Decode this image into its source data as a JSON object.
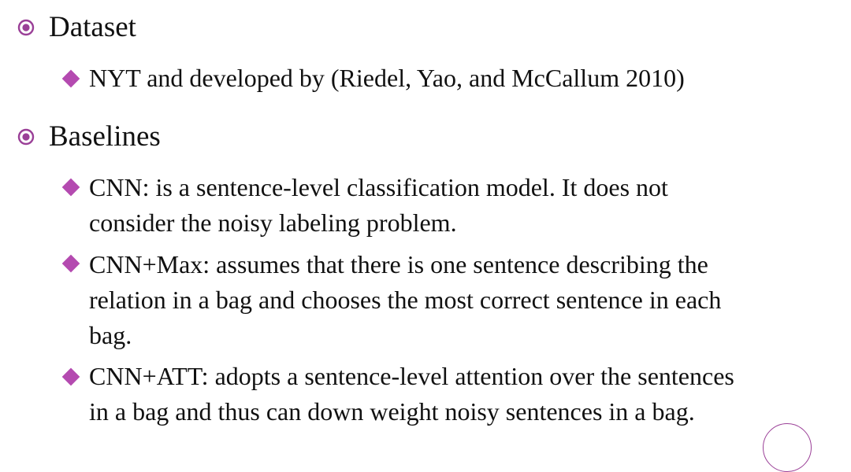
{
  "sections": [
    {
      "heading": "Dataset",
      "items": [
        {
          "lines": [
            "NYT  and developed by (Riedel, Yao, and McCallum 2010)"
          ]
        }
      ]
    },
    {
      "heading": "Baselines",
      "items": [
        {
          "lines": [
            "CNN: is a sentence-level classification model. It does not",
            "consider the noisy labeling problem."
          ]
        },
        {
          "lines": [
            "CNN+Max: assumes that there is one sentence describing the",
            "relation in a bag and  chooses the most correct sentence in each",
            "bag."
          ]
        },
        {
          "lines": [
            "CNN+ATT: adopts a sentence-level attention over the sentences",
            "in a bag and thus can down weight noisy sentences in a bag."
          ]
        }
      ]
    }
  ],
  "colors": {
    "bullet": "#9a3f97",
    "diamond": "#b44ab0",
    "text": "#111111"
  },
  "icons": {
    "level1": "circle-bullet-icon",
    "level2": "diamond-bullet-icon"
  }
}
